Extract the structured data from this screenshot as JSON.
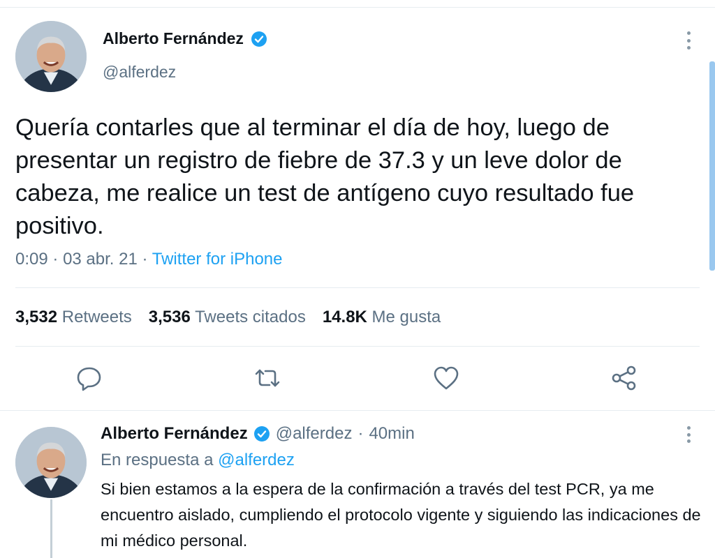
{
  "tweet": {
    "author_name": "Alberto Fernández",
    "author_handle": "@alferdez",
    "text": "Quería contarles que al terminar el día de hoy, luego de presentar un registro de fiebre de 37.3 y un leve dolor de cabeza, me realice un test de antígeno cuyo resultado fue positivo.",
    "time": "0:09",
    "date": "03 abr. 21",
    "separator": "·",
    "source": "Twitter for iPhone",
    "stats": {
      "retweets_count": "3,532",
      "retweets_label": "Retweets",
      "quotes_count": "3,536",
      "quotes_label": "Tweets citados",
      "likes_count": "14.8K",
      "likes_label": "Me gusta"
    },
    "actions": [
      "reply-icon",
      "retweet-icon",
      "like-icon",
      "share-icon"
    ]
  },
  "reply": {
    "author_name": "Alberto Fernández",
    "author_handle": "@alferdez",
    "separator": "·",
    "time_ago": "40min",
    "reply_to_label": "En respuesta a",
    "reply_to_handle": "@alferdez",
    "text": "Si bien estamos a la espera de la confirmación a través del test PCR, ya me encuentro aislado, cumpliendo el protocolo vigente y siguiendo las indicaciones de mi médico personal."
  },
  "colors": {
    "accent": "#1da1f2",
    "secondary_text": "#5b7083",
    "divider": "#e6ecf0"
  }
}
